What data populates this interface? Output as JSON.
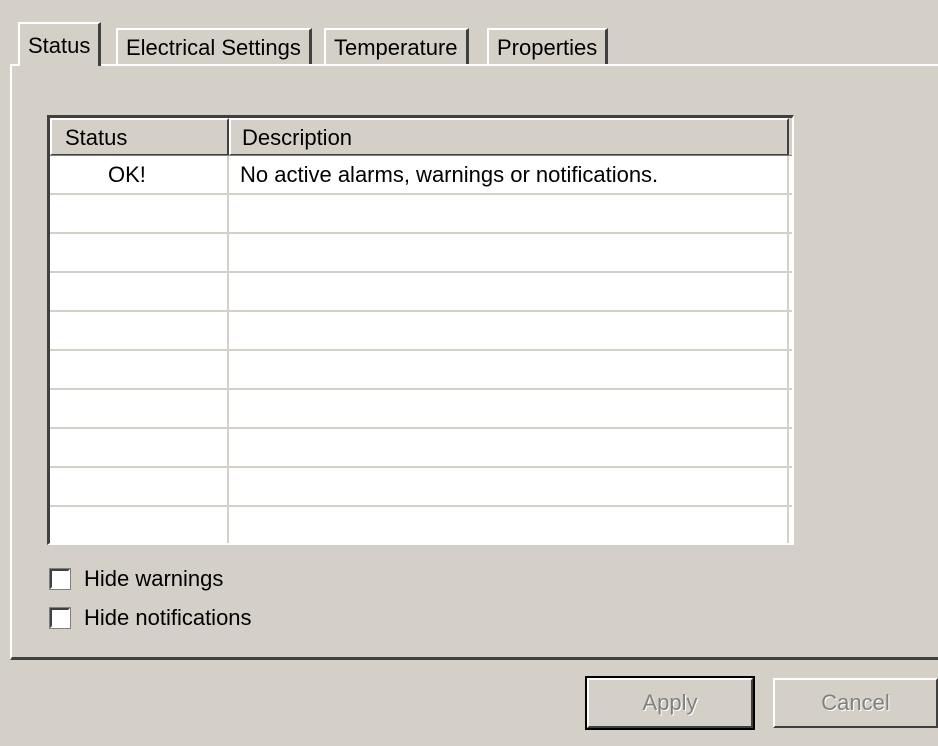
{
  "tabs": [
    {
      "label": "Status",
      "active": true
    },
    {
      "label": "Electrical Settings",
      "active": false
    },
    {
      "label": "Temperature",
      "active": false
    },
    {
      "label": "Properties",
      "active": false
    }
  ],
  "table": {
    "columns": [
      "Status",
      "Description"
    ],
    "rows": [
      {
        "status": "OK!",
        "description": "No active alarms, warnings or notifications."
      },
      {
        "status": "",
        "description": ""
      },
      {
        "status": "",
        "description": ""
      },
      {
        "status": "",
        "description": ""
      },
      {
        "status": "",
        "description": ""
      },
      {
        "status": "",
        "description": ""
      },
      {
        "status": "",
        "description": ""
      },
      {
        "status": "",
        "description": ""
      },
      {
        "status": "",
        "description": ""
      },
      {
        "status": "",
        "description": ""
      }
    ]
  },
  "options": {
    "hide_warnings": {
      "label": "Hide warnings",
      "checked": false
    },
    "hide_notifications": {
      "label": "Hide notifications",
      "checked": false
    }
  },
  "buttons": {
    "apply": {
      "label": "Apply",
      "enabled": false
    },
    "cancel": {
      "label": "Cancel",
      "enabled": false
    }
  },
  "colors": {
    "face": "#d4d0c8",
    "highlight": "#ffffff",
    "shadow": "#404040",
    "disabled_text": "#808080"
  }
}
